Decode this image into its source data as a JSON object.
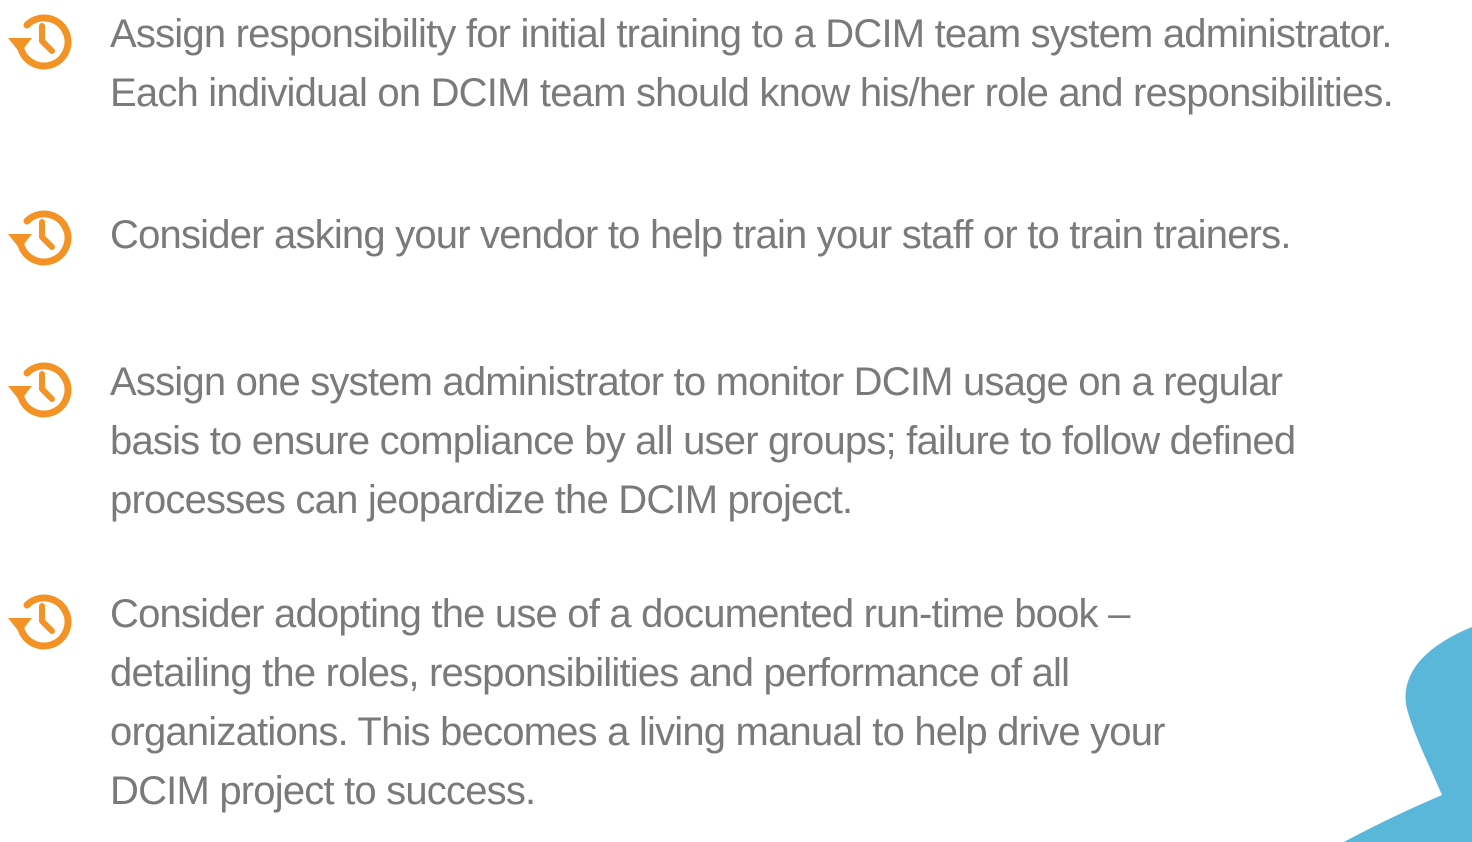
{
  "bullets": [
    {
      "icon": "history-clock-icon",
      "text": "Assign responsibility for initial training to a DCIM team system administrator.\nEach individual on DCIM team should know his/her role and responsibilities."
    },
    {
      "icon": "history-clock-icon",
      "text": "Consider asking your vendor to help train your staff or to train trainers."
    },
    {
      "icon": "history-clock-icon",
      "text": "Assign one system administrator to monitor DCIM usage on a regular\nbasis  to ensure compliance by all user groups; failure to follow defined\nprocesses can jeopardize the DCIM project."
    },
    {
      "icon": "history-clock-icon",
      "text": "Consider adopting the use of a documented run-time book –\ndetailing the roles, responsibilities and performance of all\norganizations. This becomes a living manual to help drive your\nDCIM project to success."
    }
  ],
  "colors": {
    "icon": "#F39325",
    "text": "#7A7A7A",
    "decor": "#5BB7DA"
  }
}
